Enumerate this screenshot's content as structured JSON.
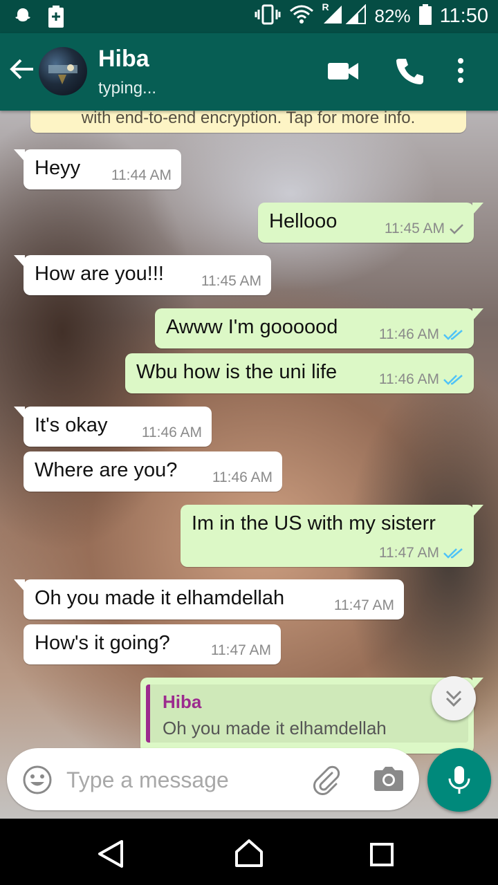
{
  "status_bar": {
    "battery": "82%",
    "time": "11:50",
    "roaming_indicator": "R"
  },
  "header": {
    "contact_name": "Hiba",
    "contact_status": "typing..."
  },
  "encryption_notice": "with end-to-end encryption. Tap for more info.",
  "messages": [
    {
      "direction": "in",
      "text": "Heyy",
      "time": "11:44 AM"
    },
    {
      "direction": "out",
      "text": "Hellooo",
      "time": "11:45 AM",
      "status": "sent"
    },
    {
      "direction": "in",
      "text": "How are you!!!",
      "time": "11:45 AM"
    },
    {
      "direction": "out",
      "text": "Awww I'm goooood",
      "time": "11:46 AM",
      "status": "read"
    },
    {
      "direction": "out",
      "text": "Wbu how is the uni life",
      "time": "11:46 AM",
      "status": "read"
    },
    {
      "direction": "in",
      "text": "It's okay",
      "time": "11:46 AM"
    },
    {
      "direction": "in",
      "text": "Where are you?",
      "time": "11:46 AM"
    },
    {
      "direction": "out",
      "text": "Im in the US with my sisterr",
      "time": "11:47 AM",
      "status": "read"
    },
    {
      "direction": "in",
      "text": "Oh you made it elhamdellah",
      "time": "11:47 AM"
    },
    {
      "direction": "in",
      "text": "How's it going?",
      "time": "11:47 AM"
    }
  ],
  "reply_preview": {
    "quoted_name": "Hiba",
    "quoted_text": "Oh you made it elhamdellah"
  },
  "composer": {
    "placeholder": "Type a message"
  },
  "colors": {
    "header": "#075e54",
    "status_bar": "#054d44",
    "outgoing_bubble": "#dcf8c6",
    "incoming_bubble": "#ffffff",
    "read_ticks": "#4fc3f7",
    "fab": "#00897b",
    "reply_accent": "#9c2b8e"
  },
  "icons": {
    "status_left": [
      "snapchat-ghost-icon",
      "battery-saver-icon"
    ],
    "status_right": [
      "vibrate-icon",
      "wifi-icon",
      "signal-icon",
      "battery-icon"
    ],
    "header": [
      "back-arrow-icon",
      "video-call-icon",
      "phone-icon",
      "more-vert-icon"
    ],
    "composer": [
      "emoji-icon",
      "attach-icon",
      "camera-icon",
      "mic-icon"
    ],
    "nav": [
      "nav-back-icon",
      "nav-home-icon",
      "nav-recents-icon"
    ]
  }
}
